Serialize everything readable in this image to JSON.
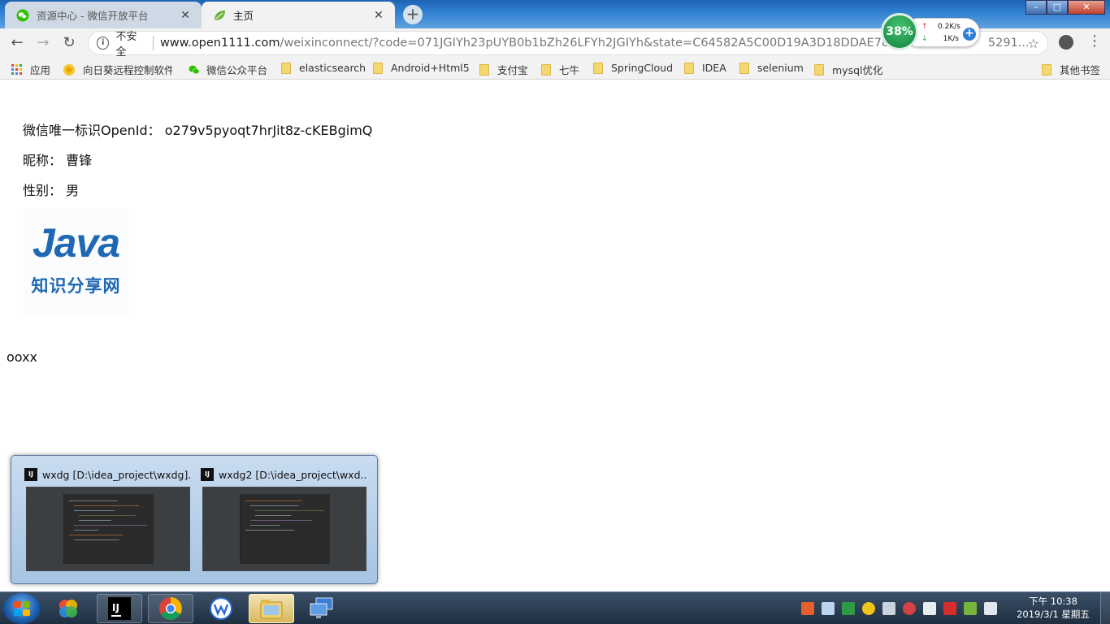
{
  "browser": {
    "tabs": [
      {
        "title": "资源中心 - 微信开放平台",
        "active": false,
        "favicon": "wechat-icon"
      },
      {
        "title": "主页",
        "active": true,
        "favicon": "leaf-icon"
      }
    ],
    "new_tab_label": "+",
    "window_controls": {
      "minimize": "–",
      "maximize": "□",
      "close": "✕"
    },
    "nav": {
      "back": "←",
      "forward": "→",
      "reload": "↻"
    },
    "address": {
      "info_icon": "i",
      "security_label": "不安全",
      "host": "www.open1111.com",
      "path": "/weixinconnect/?code=071JGIYh23pUYB0b1bZh26LFYh2JGIYh&state=C64582A5C00D19A3D18DDAE78A47BE7",
      "path_tail": "5291..."
    },
    "star": "☆",
    "menu": "⋮"
  },
  "network_widget": {
    "percent": "38%",
    "upload": "0.2K/s",
    "download": "1K/s",
    "up_arrow": "↑",
    "down_arrow": "↓",
    "plus": "+"
  },
  "bookmarks": [
    {
      "label": "应用",
      "icon": "apps-icon"
    },
    {
      "label": "向日葵远程控制软件...",
      "icon": "sunflower-icon"
    },
    {
      "label": "微信公众平台",
      "icon": "wechat-icon"
    },
    {
      "label": "elasticsearch",
      "icon": "folder-icon"
    },
    {
      "label": "Android+Html5",
      "icon": "folder-icon"
    },
    {
      "label": "支付宝",
      "icon": "folder-icon"
    },
    {
      "label": "七牛",
      "icon": "folder-icon"
    },
    {
      "label": "SpringCloud",
      "icon": "folder-icon"
    },
    {
      "label": "IDEA",
      "icon": "folder-icon"
    },
    {
      "label": "selenium",
      "icon": "folder-icon"
    },
    {
      "label": "mysql优化",
      "icon": "folder-icon"
    },
    {
      "label": "其他书签",
      "icon": "folder-icon"
    }
  ],
  "profile": {
    "openid_label": "微信唯一标识OpenId：",
    "openid_value": "o279v5pyoqt7hrJit8z-cKEBgimQ",
    "nickname_label": "昵称：",
    "nickname_value": "曹锋",
    "gender_label": "性别：",
    "gender_value": "男",
    "avatar": {
      "word": "Java",
      "subtitle": "知识分享网"
    },
    "extra_text": "ooxx"
  },
  "thumbnails": [
    {
      "title": "wxdg [D:\\idea_project\\wxdg]...",
      "icon": "intellij-icon"
    },
    {
      "title": "wxdg2 [D:\\idea_project\\wxd...",
      "icon": "intellij-icon"
    }
  ],
  "taskbar": {
    "items": [
      "start-button",
      "photos-icon",
      "intellij-icon",
      "chrome-icon",
      "wps-icon",
      "explorer-icon",
      "remote-desktop-icon"
    ],
    "clock_time": "下午 10:38",
    "clock_date": "2019/3/1 星期五"
  },
  "colors": {
    "brand_java": "#1f68b3",
    "titlebar_blue": "#2f7fd0",
    "gauge_green": "#12803e"
  }
}
